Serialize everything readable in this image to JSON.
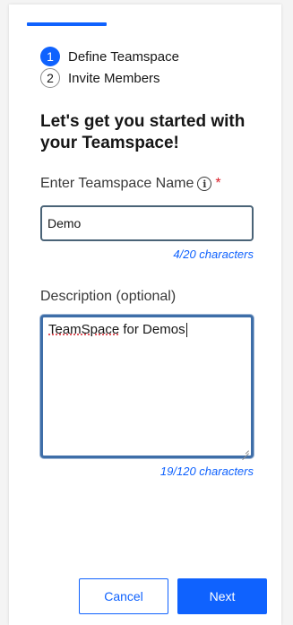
{
  "progress": {
    "fraction": 0.5
  },
  "steps": [
    {
      "number": "1",
      "label": "Define Teamspace",
      "state": "active"
    },
    {
      "number": "2",
      "label": "Invite Members",
      "state": "inactive"
    }
  ],
  "heading": "Let's get you started with your Teamspace!",
  "name_field": {
    "label": "Enter Teamspace Name",
    "info_icon": "info-icon",
    "required_mark": "*",
    "value": "Demo",
    "counter": "4/20 characters"
  },
  "description_field": {
    "label": "Description (optional)",
    "value_part1": "TeamSpace",
    "value_part2": " for Demos",
    "counter": "19/120 characters"
  },
  "buttons": {
    "cancel": "Cancel",
    "next": "Next"
  },
  "colors": {
    "accent": "#0f62fe",
    "required": "#da1e28",
    "input_border": "#4a6377",
    "focus_border": "#3e6ea8"
  }
}
